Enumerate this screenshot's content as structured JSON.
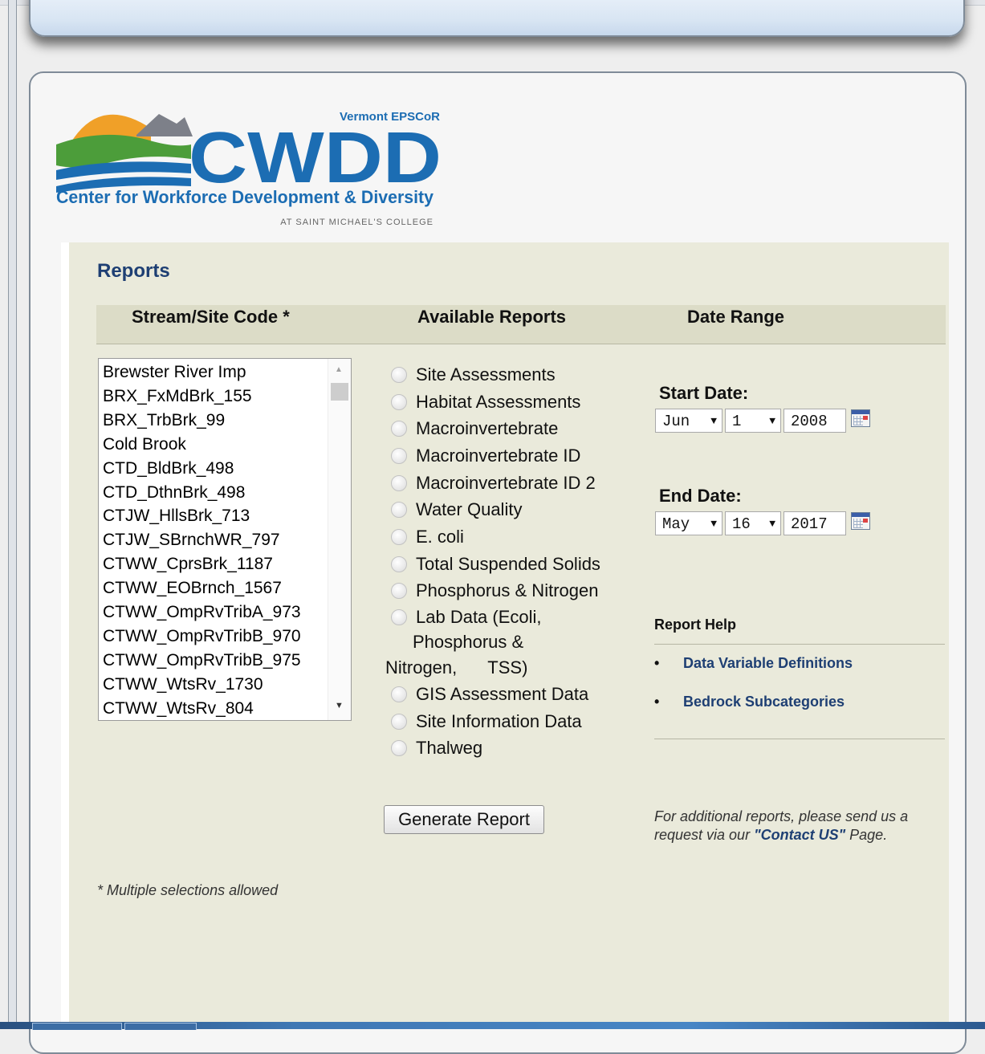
{
  "logo": {
    "org_top": "Vermont EPSCoR",
    "acronym": "CWDD",
    "full_name": "Center for Workforce Development & Diversity",
    "subline": "AT SAINT MICHAEL'S COLLEGE"
  },
  "page": {
    "title": "Reports",
    "col_site": "Stream/Site Code *",
    "col_reports": "Available Reports",
    "col_date": "Date Range",
    "footnote": "* Multiple selections allowed"
  },
  "sites": [
    "Brewster River Imp",
    "BRX_FxMdBrk_155",
    "BRX_TrbBrk_99",
    "Cold Brook",
    "CTD_BldBrk_498",
    "CTD_DthnBrk_498",
    "CTJW_HllsBrk_713",
    "CTJW_SBrnchWR_797",
    "CTWW_CprsBrk_1187",
    "CTWW_EOBrnch_1567",
    "CTWW_OmpRvTribA_973",
    "CTWW_OmpRvTribB_970",
    "CTWW_OmpRvTribB_975",
    "CTWW_WtsRv_1730",
    "CTWW_WtsRv_804"
  ],
  "reports": {
    "items_before": [
      "Site Assessments",
      "Habitat Assessments",
      "Macroinvertebrate",
      "Macroinvertebrate ID",
      "Macroinvertebrate ID 2",
      "Water Quality",
      "E. coli",
      "Total Suspended Solids",
      "Phosphorus & Nitrogen"
    ],
    "lab_line1": "Lab Data (Ecoli,",
    "lab_line2": "Phosphorus &",
    "lab_line3": "Nitrogen,",
    "lab_line3b": "TSS)",
    "items_after": [
      "GIS Assessment Data",
      "Site Information Data",
      "Thalweg"
    ],
    "generate_label": "Generate Report"
  },
  "dates": {
    "start_label": "Start Date:",
    "start_month": "Jun",
    "start_day": "1",
    "start_year": "2008",
    "end_label": "End Date:",
    "end_month": "May",
    "end_day": "16",
    "end_year": "2017"
  },
  "help": {
    "title": "Report Help",
    "bullet": "•",
    "link1": "Data Variable Definitions",
    "link2": "Bedrock Subcategories"
  },
  "note": {
    "text1": "For additional reports, please send us a request via our ",
    "link": "\"Contact US\"",
    "text2": " Page."
  },
  "colors": {
    "accent_navy": "#1e3f73",
    "content_bg": "#eaeadb",
    "logo_blue": "#1c6db3",
    "logo_orange": "#f0a028",
    "logo_green": "#4c9d3a"
  }
}
